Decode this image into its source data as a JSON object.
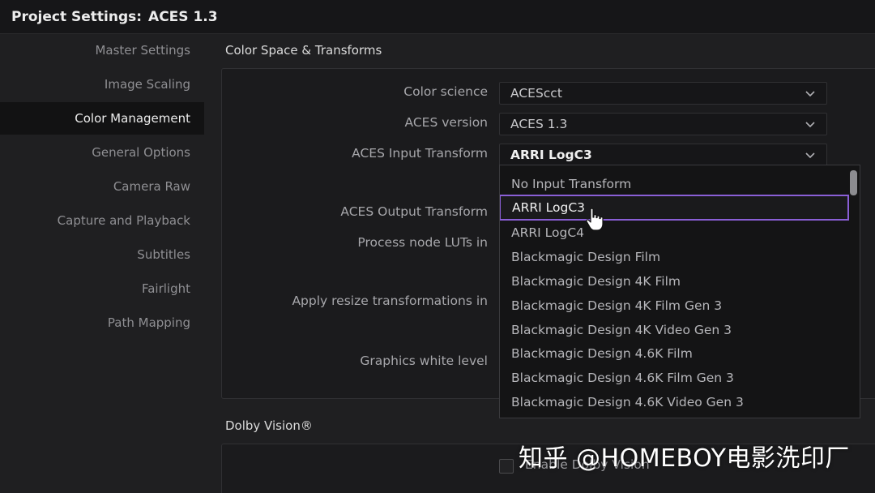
{
  "window": {
    "title_prefix": "Project Settings:",
    "title_name": "ACES 1.3"
  },
  "sidebar": {
    "items": [
      {
        "label": "Master Settings"
      },
      {
        "label": "Image Scaling"
      },
      {
        "label": "Color Management",
        "active": true
      },
      {
        "label": "General Options"
      },
      {
        "label": "Camera Raw"
      },
      {
        "label": "Capture and Playback"
      },
      {
        "label": "Subtitles"
      },
      {
        "label": "Fairlight"
      },
      {
        "label": "Path Mapping"
      }
    ]
  },
  "color_space": {
    "section_title": "Color Space & Transforms",
    "color_science": {
      "label": "Color science",
      "value": "ACEScct"
    },
    "aces_version": {
      "label": "ACES version",
      "value": "ACES 1.3"
    },
    "input_transform": {
      "label": "ACES Input Transform",
      "value": "ARRI LogC3"
    },
    "output_transform": {
      "label": "ACES Output Transform"
    },
    "process_luts": {
      "label": "Process node LUTs in"
    },
    "resize": {
      "label": "Apply resize transformations in"
    },
    "graphics_white": {
      "label": "Graphics white level"
    }
  },
  "dropdown": {
    "options": [
      "No Input Transform",
      "ARRI LogC3",
      "ARRI LogC4",
      "Blackmagic Design Film",
      "Blackmagic Design 4K Film",
      "Blackmagic Design 4K Film Gen 3",
      "Blackmagic Design 4K Video Gen 3",
      "Blackmagic Design 4.6K Film",
      "Blackmagic Design 4.6K Film Gen 3",
      "Blackmagic Design 4.6K Video Gen 3"
    ],
    "selected_index": 1,
    "highlight_color": "#8a5fd6"
  },
  "dolby": {
    "section_title": "Dolby Vision®",
    "enable_label": "Enable Dolby Vision"
  },
  "watermark": "知乎 @HOMEBOY电影洗印厂"
}
